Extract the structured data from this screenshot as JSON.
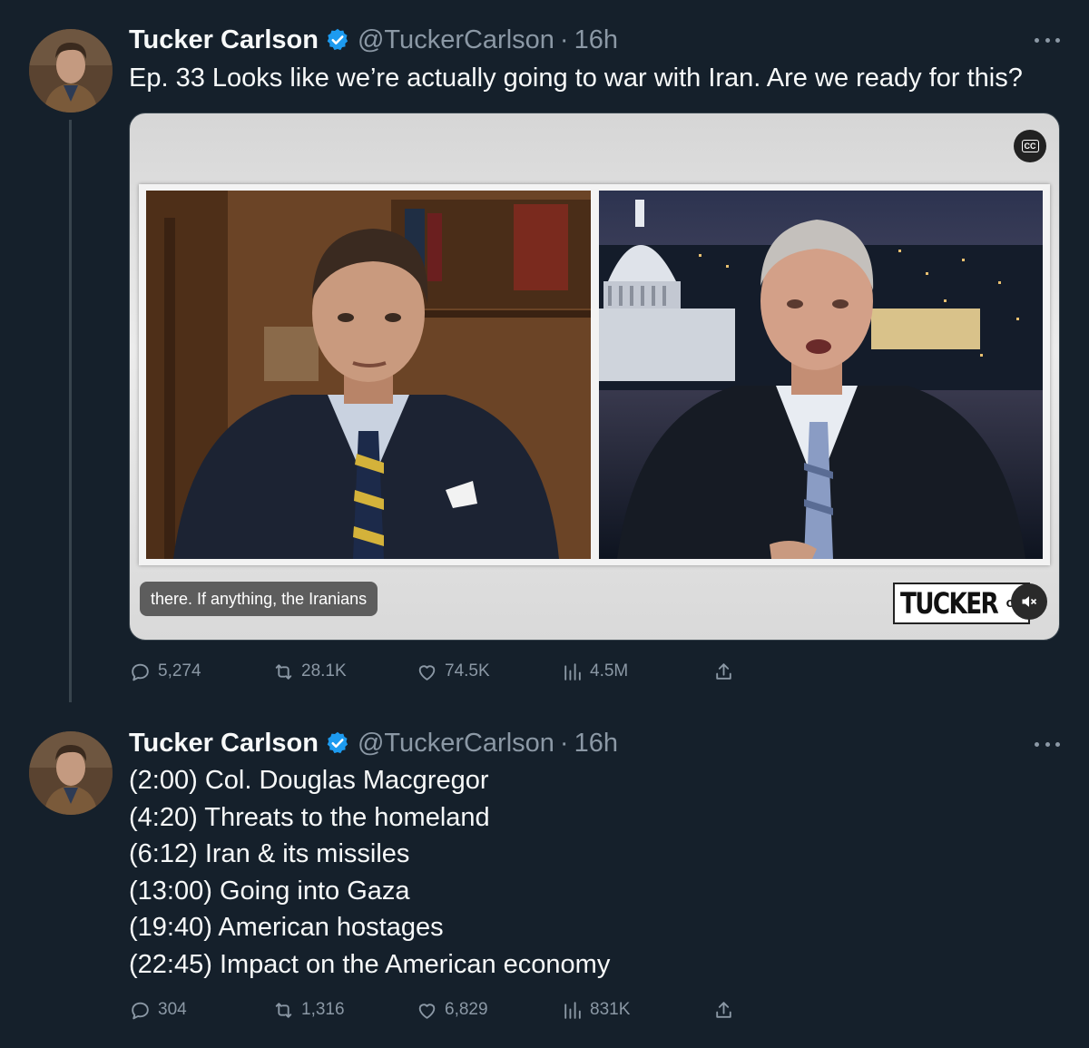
{
  "tweets": [
    {
      "author_name": "Tucker Carlson",
      "handle": "@TuckerCarlson",
      "separator": "·",
      "time": "16h",
      "text_lines": [
        "Ep. 33  Looks like we’re actually going to war with Iran. Are we ready for this?"
      ],
      "media": {
        "caption": "there. If anything, the Iranians",
        "cc_label": "CC",
        "logo_text": "TUCKER",
        "logo_on": "ON"
      },
      "stats": {
        "replies": "5,274",
        "reposts": "28.1K",
        "likes": "74.5K",
        "views": "4.5M"
      }
    },
    {
      "author_name": "Tucker Carlson",
      "handle": "@TuckerCarlson",
      "separator": "·",
      "time": "16h",
      "text_lines": [
        "(2:00) Col. Douglas Macgregor",
        "(4:20) Threats to the homeland",
        "(6:12) Iran & its missiles",
        "(13:00) Going into Gaza",
        "(19:40) American hostages",
        "(22:45) Impact on the American economy"
      ],
      "stats": {
        "replies": "304",
        "reposts": "1,316",
        "likes": "6,829",
        "views": "831K"
      }
    }
  ],
  "colors": {
    "background": "#15202b",
    "secondary_text": "#8b98a5",
    "verified_badge": "#1d9bf0",
    "thread_line": "#38444d"
  },
  "icons": [
    "verified-badge-icon",
    "more-icon",
    "reply-icon",
    "repost-icon",
    "like-icon",
    "views-icon",
    "share-icon",
    "cc-icon",
    "mute-icon"
  ]
}
